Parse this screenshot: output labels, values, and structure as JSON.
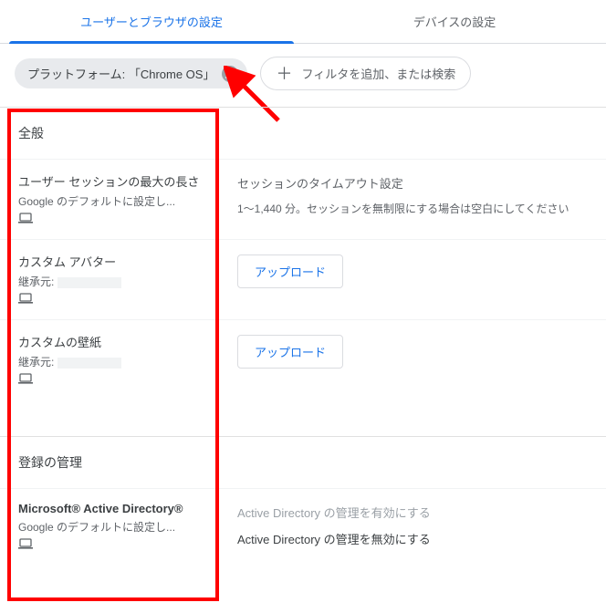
{
  "tabs": {
    "user_browser": "ユーザーとブラウザの設定",
    "device": "デバイスの設定"
  },
  "filter": {
    "chip_label": "プラットフォーム: 「Chrome OS」",
    "add_placeholder": "フィルタを追加、または検索"
  },
  "sections": {
    "general": {
      "title": "全般",
      "items": {
        "session_length": {
          "label": "ユーザー セッションの最大の長さ",
          "sub": "Google のデフォルトに設定し...",
          "right_heading": "セッションのタイムアウト設定",
          "right_desc": "1〜1,440 分。セッションを無制限にする場合は空白にしてください"
        },
        "custom_avatar": {
          "label": "カスタム アバター",
          "sub_prefix": "継承元:",
          "button": "アップロード"
        },
        "custom_wallpaper": {
          "label": "カスタムの壁紙",
          "sub_prefix": "継承元:",
          "button": "アップロード"
        }
      }
    },
    "enrollment": {
      "title": "登録の管理",
      "items": {
        "msad": {
          "label": "Microsoft® Active Directory®",
          "sub": "Google のデフォルトに設定し...",
          "right_line1": "Active Directory の管理を有効にする",
          "right_line2": "Active Directory の管理を無効にする"
        }
      }
    }
  }
}
